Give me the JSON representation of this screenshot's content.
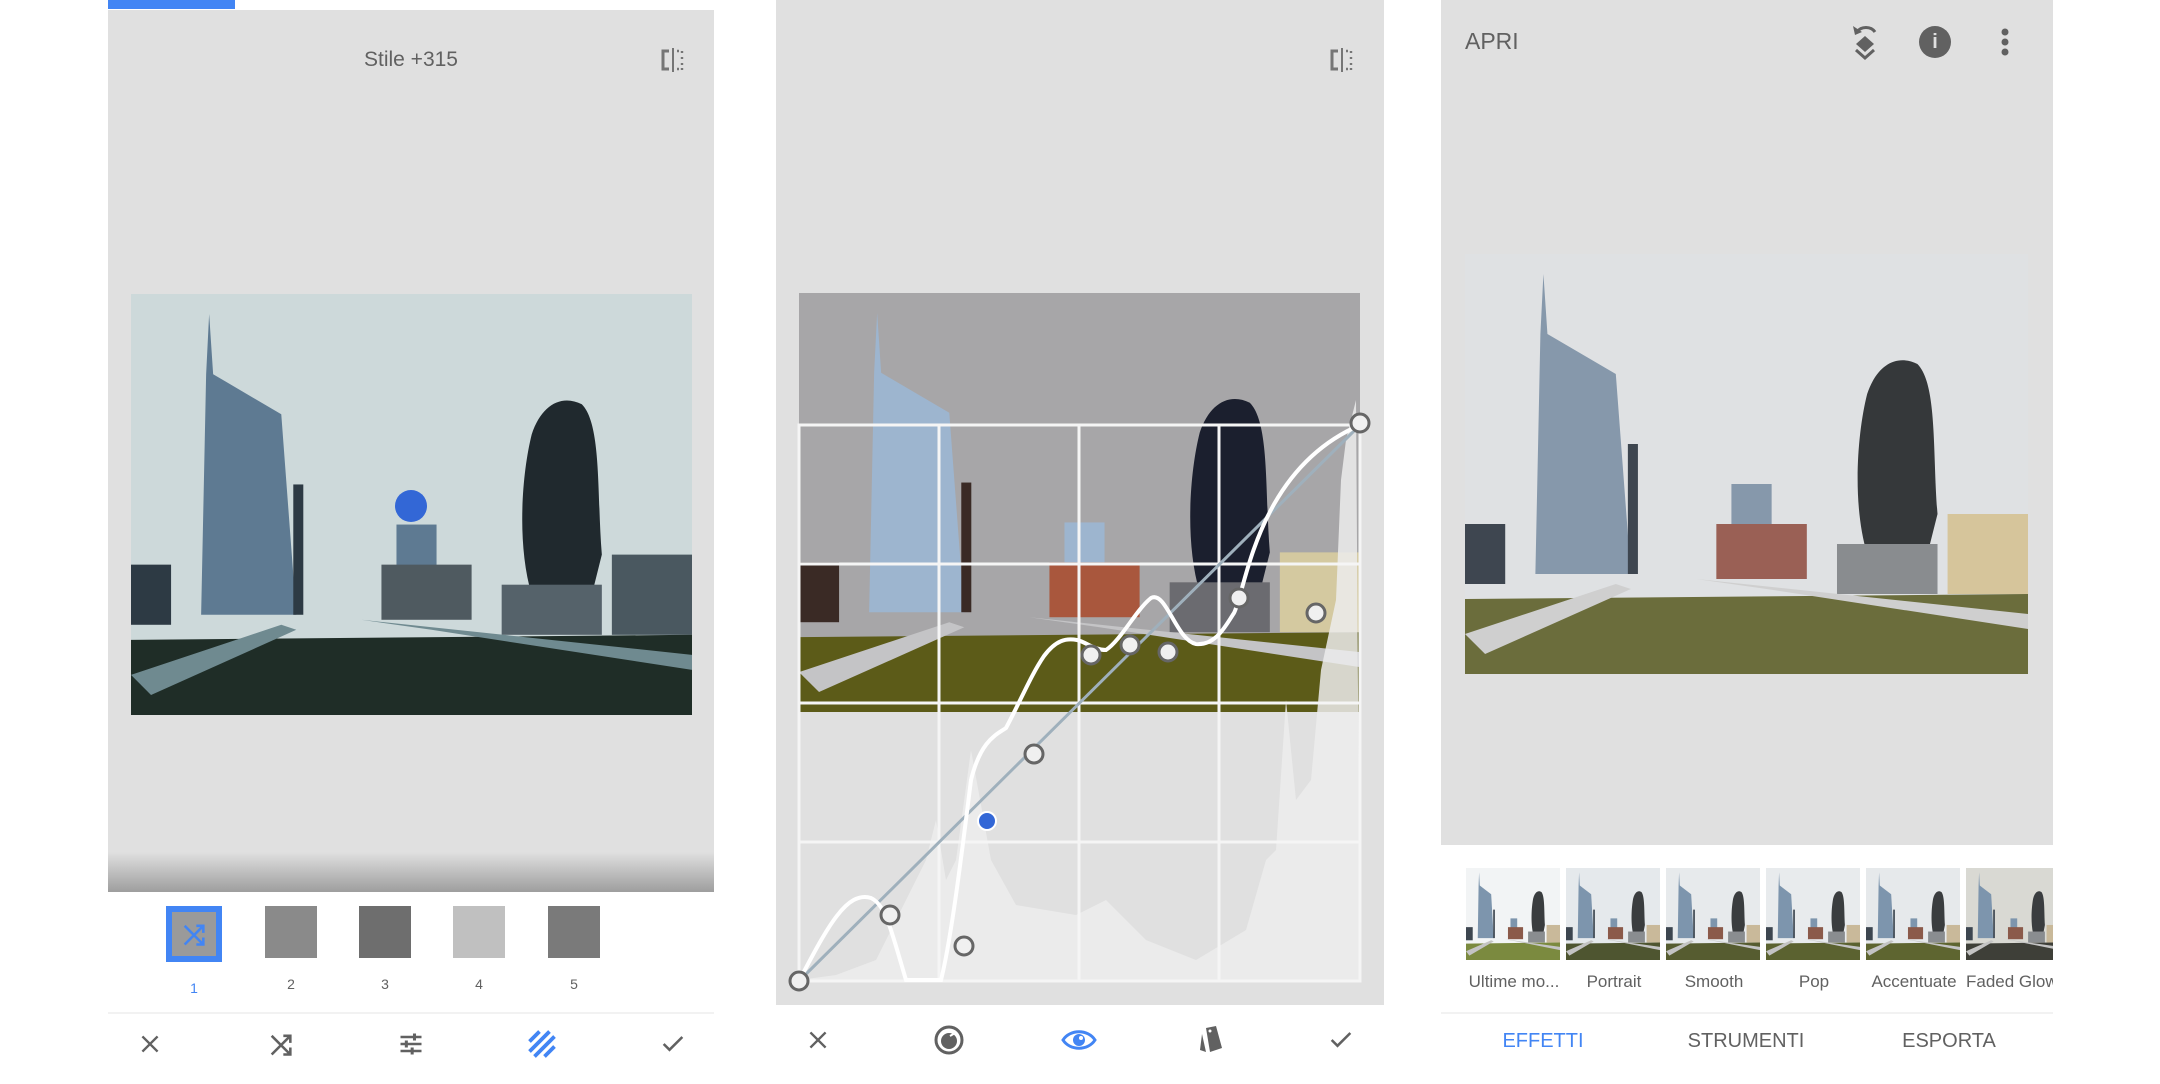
{
  "panels": {
    "style_editor": {
      "title": "Stile +315",
      "progress_fraction": 0.2,
      "styles": [
        {
          "number": "1",
          "selected": true
        },
        {
          "number": "2",
          "selected": false
        },
        {
          "number": "3",
          "selected": false
        },
        {
          "number": "4",
          "selected": false
        },
        {
          "number": "5",
          "selected": false
        }
      ],
      "toolbar": [
        "close",
        "shuffle",
        "tune",
        "style-texture",
        "apply"
      ],
      "active_tool": "style-texture"
    },
    "curves_editor": {
      "toolbar": [
        "close",
        "curve-channel",
        "view-eye",
        "presets",
        "apply"
      ],
      "active_tool": "view-eye",
      "curve_points_note": "curve control points plotted on grid"
    },
    "home": {
      "title": "APRI",
      "header_icons": [
        "undo-layers",
        "info",
        "more-vert"
      ],
      "effects": [
        {
          "label": "Ultime mo..."
        },
        {
          "label": "Portrait"
        },
        {
          "label": "Smooth"
        },
        {
          "label": "Pop"
        },
        {
          "label": "Accentuate"
        },
        {
          "label": "Faded Glow"
        }
      ],
      "tabs": [
        {
          "label": "EFFETTI",
          "active": true
        },
        {
          "label": "STRUMENTI",
          "active": false
        },
        {
          "label": "ESPORTA",
          "active": false
        }
      ]
    }
  },
  "colors": {
    "accent": "#4285f4",
    "selected_dot": "#3367d6",
    "icon": "#616161",
    "panel_bg": "#e0e0e0"
  }
}
